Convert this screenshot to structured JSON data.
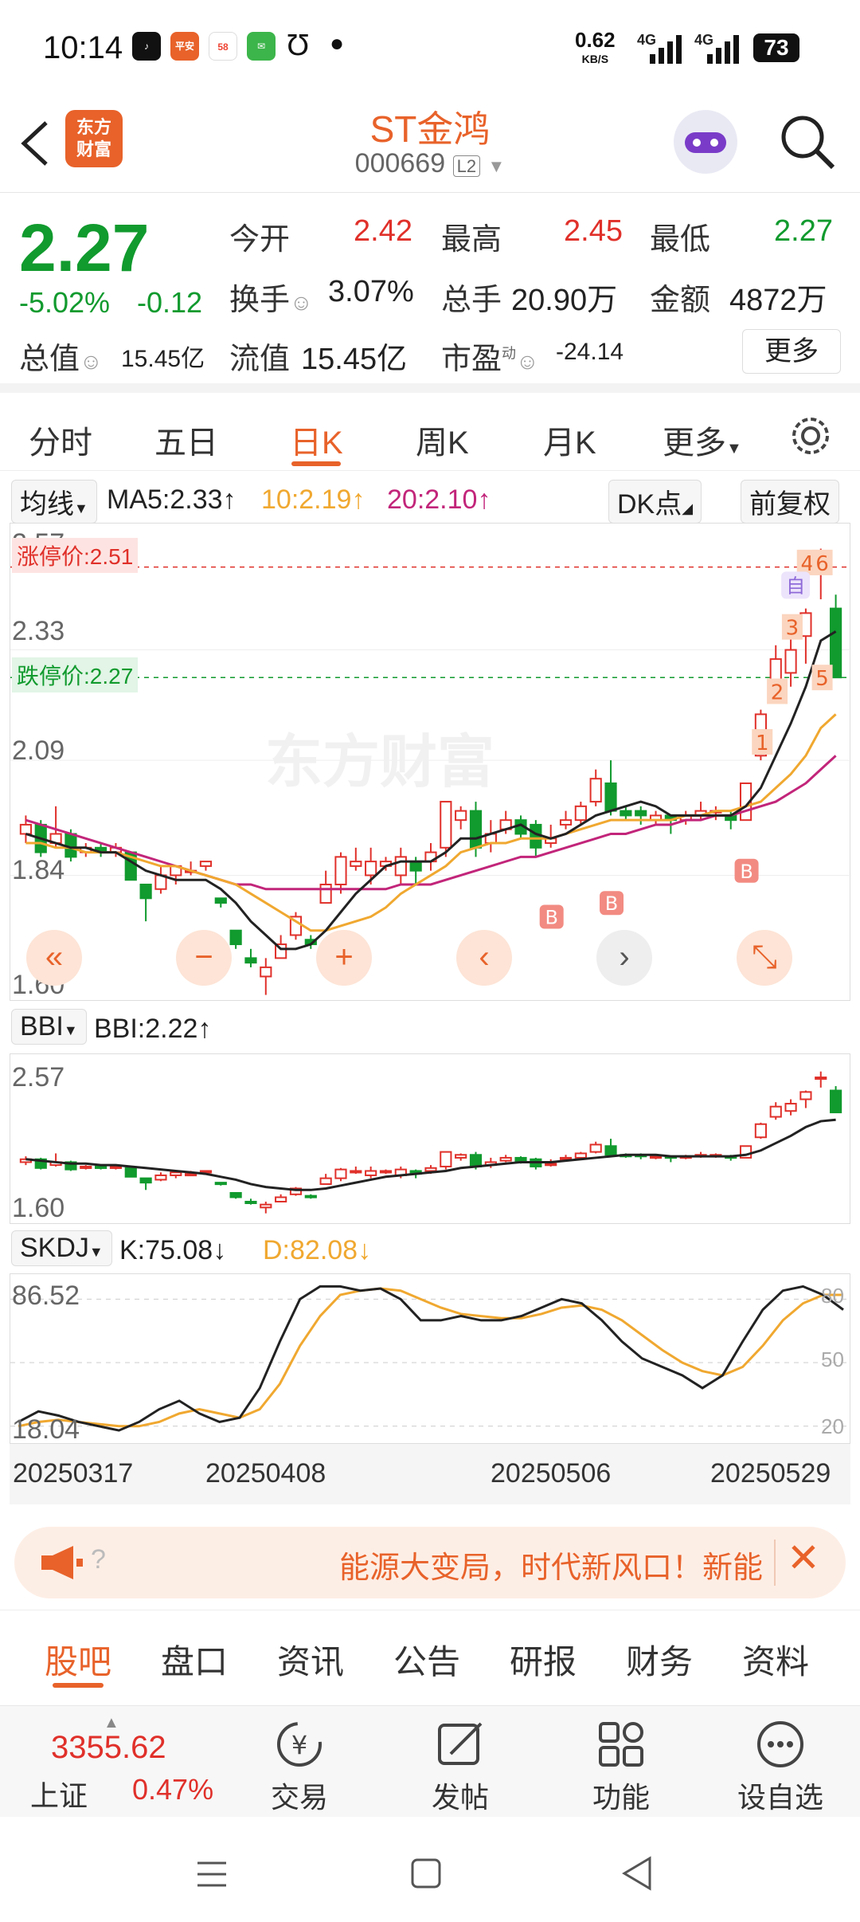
{
  "status_bar": {
    "time": "10:14",
    "speed": "0.62",
    "speed_unit": "KB/S",
    "net1": "4G",
    "net2": "4G",
    "battery": "73"
  },
  "header": {
    "back_icon": "back-arrow-icon",
    "logo_line1": "东方",
    "logo_line2": "财富",
    "title": "ST金鸿",
    "code": "000669",
    "level": "L2"
  },
  "quote": {
    "price": "2.27",
    "change_pct": "-5.02%",
    "change": "-0.12",
    "open_label": "今开",
    "open": "2.42",
    "high_label": "最高",
    "high": "2.45",
    "low_label": "最低",
    "low": "2.27",
    "turnover_label": "换手",
    "turnover": "3.07%",
    "volume_label": "总手",
    "volume": "20.90万",
    "amount_label": "金额",
    "amount": "4872万",
    "mktcap_label": "总值",
    "mktcap": "15.45亿",
    "float_label": "流值",
    "float_cap": "15.45亿",
    "pe_label": "市盈",
    "pe_sup": "动",
    "pe": "-24.14",
    "more": "更多"
  },
  "tabs": [
    "分时",
    "五日",
    "日K",
    "周K",
    "月K",
    "更多"
  ],
  "active_tab": 2,
  "ma_bar": {
    "type": "均线",
    "ma5": "MA5:2.33",
    "ma10": "10:2.19",
    "ma20": "20:2.10",
    "dk": "DK点",
    "rights": "前复权"
  },
  "kline": {
    "y_labels": [
      "2.57",
      "2.33",
      "2.09",
      "1.84",
      "1.60"
    ],
    "limit_up": "涨停价:2.51",
    "limit_down": "跌停价:2.27",
    "watermark": "东方财富",
    "markers": [
      "1",
      "2",
      "3",
      "4",
      "5",
      "6"
    ],
    "self_marker": "自",
    "buy_marker": "B"
  },
  "bbi_bar": {
    "type": "BBI",
    "value": "BBI:2.22"
  },
  "bbi": {
    "y_labels": [
      "2.57",
      "1.60"
    ]
  },
  "skdj_bar": {
    "type": "SKDJ",
    "k": "K:75.08",
    "d": "D:82.08"
  },
  "skdj": {
    "y_labels": [
      "86.52",
      "18.04"
    ],
    "right_labels": [
      "80",
      "50",
      "20"
    ]
  },
  "x_dates": [
    "20250317",
    "20250408",
    "20250506",
    "20250529"
  ],
  "news": {
    "text": "能源大变局，时代新风口！新能",
    "q": "?"
  },
  "bottom_tabs": [
    "股吧",
    "盘口",
    "资讯",
    "公告",
    "研报",
    "财务",
    "资料"
  ],
  "dock": {
    "index_value": "3355.62",
    "index_name": "上证",
    "index_pct": "0.47%",
    "trade": "交易",
    "post": "发帖",
    "func": "功能",
    "watch": "设自选"
  },
  "colors": {
    "up": "#e0302a",
    "down": "#119a2e",
    "accent": "#e8622a",
    "ma5": "#222222",
    "ma10": "#f0a830",
    "ma20": "#c2257a"
  },
  "chart_data": {
    "type": "candlestick",
    "price_axis": [
      1.6,
      2.57
    ],
    "candles": [
      [
        1.93,
        1.95,
        1.97,
        1.91
      ],
      [
        1.95,
        1.89,
        1.96,
        1.88
      ],
      [
        1.91,
        1.93,
        1.99,
        1.9
      ],
      [
        1.93,
        1.88,
        1.94,
        1.87
      ],
      [
        1.89,
        1.9,
        1.91,
        1.88
      ],
      [
        1.9,
        1.89,
        1.91,
        1.88
      ],
      [
        1.89,
        1.9,
        1.91,
        1.88
      ],
      [
        1.89,
        1.83,
        1.89,
        1.83
      ],
      [
        1.82,
        1.79,
        1.82,
        1.74
      ],
      [
        1.81,
        1.84,
        1.86,
        1.8
      ],
      [
        1.84,
        1.86,
        1.86,
        1.82
      ],
      [
        1.85,
        1.85,
        1.87,
        1.84
      ],
      [
        1.86,
        1.87,
        1.87,
        1.85
      ],
      [
        1.79,
        1.78,
        1.79,
        1.77
      ],
      [
        1.72,
        1.69,
        1.71,
        1.68
      ],
      [
        1.66,
        1.65,
        1.68,
        1.64
      ],
      [
        1.62,
        1.64,
        1.66,
        1.58
      ],
      [
        1.66,
        1.69,
        1.71,
        1.66
      ],
      [
        1.71,
        1.75,
        1.76,
        1.7
      ],
      [
        1.7,
        1.69,
        1.71,
        1.68
      ],
      [
        1.78,
        1.82,
        1.85,
        1.78
      ],
      [
        1.82,
        1.88,
        1.89,
        1.8
      ],
      [
        1.86,
        1.87,
        1.9,
        1.85
      ],
      [
        1.84,
        1.87,
        1.9,
        1.82
      ],
      [
        1.86,
        1.87,
        1.88,
        1.85
      ],
      [
        1.84,
        1.88,
        1.9,
        1.82
      ],
      [
        1.87,
        1.85,
        1.88,
        1.82
      ],
      [
        1.87,
        1.89,
        1.91,
        1.85
      ],
      [
        1.9,
        2.0,
        2.0,
        1.88
      ],
      [
        1.96,
        1.98,
        1.99,
        1.94
      ],
      [
        1.98,
        1.9,
        2.0,
        1.88
      ],
      [
        1.91,
        1.93,
        1.96,
        1.89
      ],
      [
        1.94,
        1.96,
        1.98,
        1.93
      ],
      [
        1.96,
        1.93,
        1.97,
        1.92
      ],
      [
        1.95,
        1.9,
        1.96,
        1.88
      ],
      [
        1.91,
        1.92,
        1.95,
        1.9
      ],
      [
        1.95,
        1.96,
        1.98,
        1.94
      ],
      [
        1.96,
        1.99,
        2.0,
        1.95
      ],
      [
        2.0,
        2.05,
        2.07,
        1.99
      ],
      [
        2.04,
        1.98,
        2.09,
        1.97
      ],
      [
        1.98,
        1.97,
        1.99,
        1.96
      ],
      [
        1.98,
        1.97,
        1.99,
        1.95
      ],
      [
        1.96,
        1.97,
        1.98,
        1.95
      ],
      [
        1.97,
        1.96,
        1.97,
        1.93
      ],
      [
        1.96,
        1.97,
        1.98,
        1.95
      ],
      [
        1.97,
        1.98,
        2.0,
        1.96
      ],
      [
        1.98,
        1.98,
        1.99,
        1.96
      ],
      [
        1.97,
        1.96,
        1.98,
        1.94
      ],
      [
        1.96,
        2.04,
        2.04,
        1.96
      ],
      [
        2.1,
        2.19,
        2.2,
        2.09
      ],
      [
        2.24,
        2.31,
        2.34,
        2.22
      ],
      [
        2.28,
        2.33,
        2.36,
        2.25
      ],
      [
        2.36,
        2.41,
        2.42,
        2.3
      ],
      [
        2.51,
        2.51,
        2.55,
        2.44
      ],
      [
        2.42,
        2.27,
        2.45,
        2.27
      ]
    ],
    "ma5_line": [
      1.93,
      1.92,
      1.91,
      1.9,
      1.9,
      1.89,
      1.89,
      1.87,
      1.85,
      1.84,
      1.83,
      1.83,
      1.83,
      1.81,
      1.78,
      1.74,
      1.71,
      1.68,
      1.68,
      1.69,
      1.72,
      1.76,
      1.8,
      1.83,
      1.86,
      1.87,
      1.87,
      1.87,
      1.89,
      1.92,
      1.92,
      1.93,
      1.94,
      1.95,
      1.93,
      1.92,
      1.93,
      1.95,
      1.97,
      1.98,
      1.99,
      2.0,
      1.99,
      1.97,
      1.97,
      1.97,
      1.97,
      1.97,
      1.99,
      2.03,
      2.1,
      2.17,
      2.25,
      2.35,
      2.37
    ],
    "ma10_line": [
      1.91,
      1.91,
      1.9,
      1.9,
      1.89,
      1.89,
      1.89,
      1.88,
      1.87,
      1.86,
      1.86,
      1.85,
      1.84,
      1.83,
      1.82,
      1.8,
      1.78,
      1.76,
      1.74,
      1.72,
      1.72,
      1.73,
      1.74,
      1.75,
      1.77,
      1.8,
      1.82,
      1.84,
      1.86,
      1.89,
      1.9,
      1.91,
      1.91,
      1.92,
      1.92,
      1.92,
      1.93,
      1.94,
      1.95,
      1.96,
      1.96,
      1.96,
      1.96,
      1.96,
      1.97,
      1.97,
      1.98,
      1.98,
      1.99,
      2.0,
      2.03,
      2.06,
      2.1,
      2.16,
      2.19
    ],
    "ma20_line": [
      1.96,
      1.95,
      1.94,
      1.93,
      1.92,
      1.91,
      1.9,
      1.89,
      1.88,
      1.87,
      1.86,
      1.85,
      1.84,
      1.83,
      1.82,
      1.82,
      1.81,
      1.81,
      1.81,
      1.81,
      1.81,
      1.81,
      1.81,
      1.81,
      1.81,
      1.82,
      1.82,
      1.82,
      1.83,
      1.84,
      1.85,
      1.86,
      1.87,
      1.88,
      1.88,
      1.89,
      1.9,
      1.91,
      1.92,
      1.93,
      1.93,
      1.94,
      1.95,
      1.95,
      1.96,
      1.96,
      1.97,
      1.97,
      1.98,
      1.99,
      2.0,
      2.02,
      2.04,
      2.07,
      2.1
    ],
    "bbi_line": [
      1.95,
      1.94,
      1.93,
      1.92,
      1.92,
      1.91,
      1.91,
      1.9,
      1.89,
      1.88,
      1.87,
      1.86,
      1.85,
      1.83,
      1.81,
      1.78,
      1.76,
      1.75,
      1.74,
      1.74,
      1.75,
      1.77,
      1.79,
      1.81,
      1.83,
      1.84,
      1.85,
      1.86,
      1.87,
      1.89,
      1.9,
      1.91,
      1.92,
      1.93,
      1.93,
      1.93,
      1.94,
      1.95,
      1.96,
      1.97,
      1.98,
      1.98,
      1.98,
      1.97,
      1.97,
      1.97,
      1.97,
      1.97,
      1.98,
      2.01,
      2.06,
      2.11,
      2.17,
      2.21,
      2.22
    ],
    "skdj_axis": [
      18.04,
      86.52
    ],
    "skdj_k": [
      22,
      27,
      25,
      22,
      20,
      18,
      22,
      28,
      32,
      26,
      22,
      24,
      38,
      60,
      80,
      86,
      86,
      84,
      85,
      80,
      70,
      70,
      72,
      70,
      70,
      72,
      76,
      80,
      78,
      70,
      60,
      52,
      48,
      44,
      38,
      44,
      60,
      75,
      84,
      86,
      82,
      75
    ],
    "skdj_d": [
      20,
      22,
      23,
      22,
      21,
      20,
      20,
      22,
      26,
      28,
      26,
      24,
      28,
      40,
      58,
      72,
      82,
      84,
      85,
      84,
      80,
      76,
      73,
      72,
      71,
      71,
      73,
      76,
      77,
      75,
      70,
      63,
      56,
      50,
      46,
      44,
      48,
      58,
      70,
      78,
      82,
      82
    ]
  }
}
